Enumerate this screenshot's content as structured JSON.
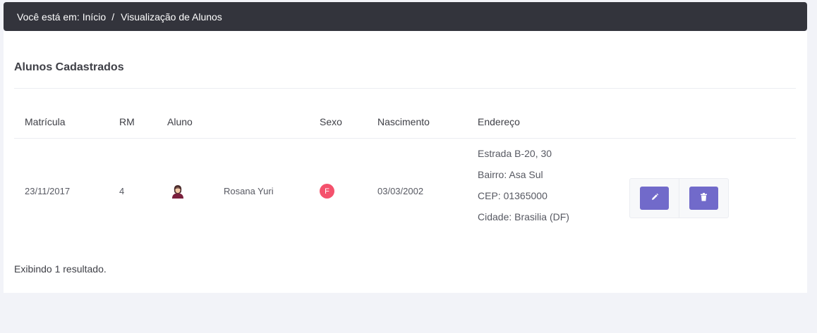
{
  "breadcrumb": {
    "prefix": "Você está em:",
    "home": "Início",
    "separator": "/",
    "current": "Visualização de Alunos"
  },
  "card": {
    "title": "Alunos Cadastrados"
  },
  "table": {
    "headers": [
      "Matrícula",
      "RM",
      "Aluno",
      "Sexo",
      "Nascimento",
      "Endereço"
    ],
    "rows": [
      {
        "matricula": "23/11/2017",
        "rm": "4",
        "avatar_icon": "female-user-icon",
        "aluno": "Rosana Yuri",
        "sexo": "F",
        "nascimento": "03/03/2002",
        "endereco": {
          "linha1": "Estrada B-20, 30",
          "bairro": "Bairro: Asa Sul",
          "cep": "CEP: 01365000",
          "cidade": "Cidade: Brasilia (DF)"
        },
        "actions": {
          "edit_icon": "pencil-icon",
          "delete_icon": "trash-icon"
        }
      }
    ]
  },
  "footer": {
    "results_text": "Exibindo 1 resultado."
  },
  "colors": {
    "header_bg": "#33343c",
    "accent": "#716aca",
    "badge_female": "#f4516c"
  }
}
